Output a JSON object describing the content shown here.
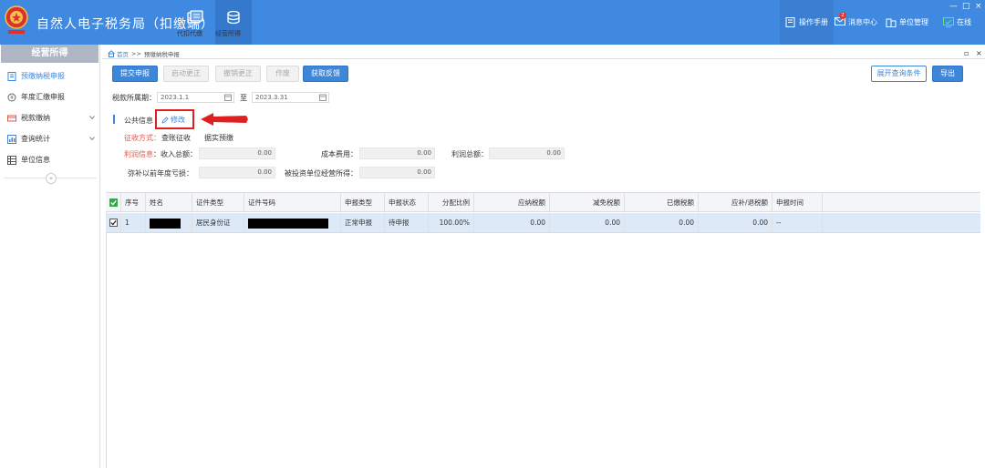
{
  "header": {
    "app_title": "自然人电子税务局（扣缴端）",
    "nav": [
      {
        "label": "代扣代缴",
        "icon": "withholding-icon"
      },
      {
        "label": "经营所得",
        "icon": "coins-icon"
      }
    ],
    "right_nav": [
      {
        "label": "操作手册",
        "icon": "manual-icon"
      },
      {
        "label": "消息中心",
        "icon": "message-icon",
        "badge": "2"
      },
      {
        "label": "单位管理",
        "icon": "building-icon"
      },
      {
        "label": "在线",
        "icon": "online-icon"
      }
    ],
    "window_controls": [
      "—",
      "□",
      "×"
    ]
  },
  "sidebar": {
    "title": "经营所得",
    "items": [
      {
        "label": "预缴纳税申报",
        "icon": "declare-icon",
        "active": true
      },
      {
        "label": "年度汇缴申报",
        "icon": "annual-icon"
      },
      {
        "label": "税款缴纳",
        "icon": "payment-icon",
        "expandable": true
      },
      {
        "label": "查询统计",
        "icon": "query-icon",
        "expandable": true
      },
      {
        "label": "单位信息",
        "icon": "unit-info-icon"
      }
    ],
    "collapse_glyph": "«"
  },
  "breadcrumb": {
    "home": "首页",
    "separator": ">>",
    "current": "预缴纳税申报"
  },
  "toolbar": {
    "submit": "提交申报",
    "start_correction": "启动更正",
    "cancel_correction": "撤销更正",
    "void": "作废",
    "get_feedback": "获取反馈",
    "expand_query": "展开查询条件",
    "export": "导出"
  },
  "period": {
    "label": "税款所属期：",
    "from": "2023.1.1",
    "to_label": "至",
    "to": "2023.3.31"
  },
  "public_info": {
    "label": "公共信息",
    "edit_label": "修改",
    "levy_method_label": "征收方式：",
    "levy_method_value": "查账征收",
    "prepay_basis": "据实预缴",
    "profit_info_label": "利润信息",
    "income_label": "：收入总额：",
    "income_value": "0.00",
    "cost_label": "成本费用：",
    "cost_value": "0.00",
    "profit_label": "利润总额：",
    "profit_value": "0.00",
    "loss_label": "弥补以前年度亏损：",
    "loss_value": "0.00",
    "invested_label": "被投资单位经营所得：",
    "invested_value": "0.00"
  },
  "table": {
    "columns": [
      "序号",
      "姓名",
      "证件类型",
      "证件号码",
      "申报类型",
      "申报状态",
      "分配比例",
      "应纳税额",
      "减免税额",
      "已缴税额",
      "应补/退税额",
      "申报时间"
    ],
    "rows": [
      {
        "no": "1",
        "name": "",
        "id_type": "居民身份证",
        "id_number": "",
        "declare_type": "正常申报",
        "declare_status": "待申报",
        "ratio": "100.00%",
        "tax_payable": "0.00",
        "tax_relief": "0.00",
        "tax_paid": "0.00",
        "tax_due": "0.00",
        "declare_time": "--"
      }
    ]
  },
  "colors": {
    "header_bg": "#3f8ae0",
    "primary": "#3e86d8",
    "highlight_red": "#e02020",
    "row_selected": "#dde9f7"
  }
}
